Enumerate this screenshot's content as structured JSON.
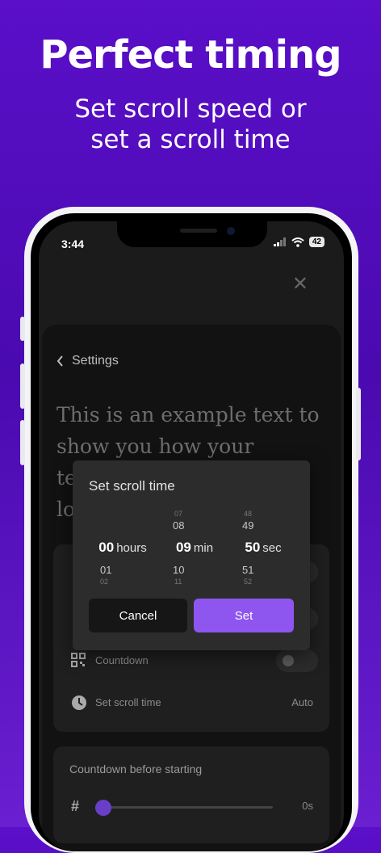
{
  "headline": "Perfect timing",
  "subheadline_line1": "Set scroll speed or",
  "subheadline_line2": "set a scroll time",
  "status": {
    "time": "3:44",
    "battery": "42"
  },
  "settings": {
    "back_label": "Settings",
    "example_lines": [
      "This is an example text to",
      "show you how your",
      "te",
      "lo"
    ],
    "rows": [
      {
        "label": "Countdown",
        "icon": "qr-code-icon"
      },
      {
        "label": "Set scroll time",
        "icon": "clock-icon",
        "value": "Auto"
      }
    ],
    "countdown_card": {
      "title": "Countdown before starting",
      "hash": "#",
      "value": "0s",
      "slider_fraction": 0.0
    }
  },
  "dialog": {
    "title": "Set scroll time",
    "hours": {
      "prev2": "",
      "prev": "",
      "selected": "00",
      "unit": "hours",
      "next": "01",
      "next2": "02"
    },
    "minutes": {
      "prev2": "07",
      "prev": "08",
      "selected": "09",
      "unit": "min",
      "next": "10",
      "next2": "11"
    },
    "seconds": {
      "prev2": "48",
      "prev": "49",
      "selected": "50",
      "unit": "sec",
      "next": "51",
      "next2": "52"
    },
    "cancel_label": "Cancel",
    "set_label": "Set"
  },
  "colors": {
    "accent": "#8e56ef",
    "background_top": "#5a0fc8"
  }
}
